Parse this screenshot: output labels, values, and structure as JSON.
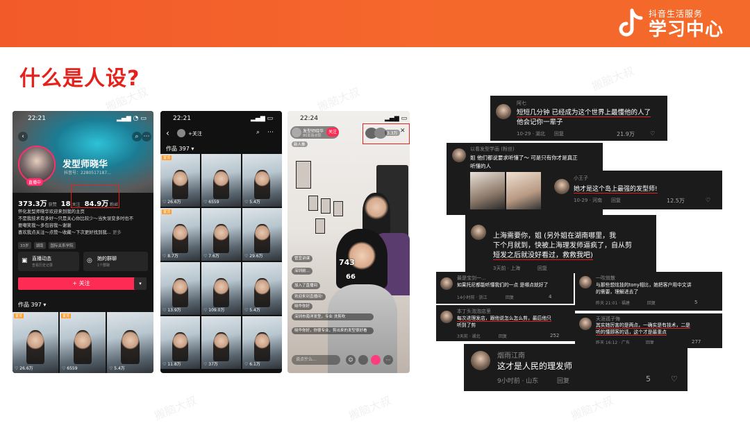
{
  "brand": {
    "small": "抖音生活服务",
    "big": "学习中心"
  },
  "title": "什么是人设?",
  "watermark": "搬脑大叔",
  "phone1": {
    "time": "22:21",
    "name": "发型师晓华",
    "id": "抖音号：2280517187...",
    "live": "直播中",
    "likes_value": "373.3万",
    "likes_label": "获赞",
    "following_value": "18",
    "following_label": "关注",
    "fans_value": "84.9万",
    "fans_label": "粉丝",
    "bio": [
      "怀化发型师晓华欢迎来到我的主页",
      "不是我技术有多好～只是关心你比较少～当失误变多时也不",
      "要嘲笑我～多包容我～谢谢",
      "喜欢我点关注～点赞～收藏～下次更好找到我..."
    ],
    "bio_more": "更多",
    "tags": [
      "33岁",
      "湖南",
      "国际关系学院"
    ],
    "card1_title": "直播动态",
    "card1_sub": "查看历史记录",
    "card2_title": "她的群聊",
    "card2_sub": "1个群聊",
    "follow_label": "+ 关注",
    "more_label": "▾",
    "works_label": "作品 397 ▾",
    "thumbs": [
      {
        "count": "♡ 26.6万",
        "pin": "置顶"
      },
      {
        "count": "♡ 6559",
        "pin": "置顶"
      },
      {
        "count": "♡ 5.4万",
        "pin": ""
      }
    ]
  },
  "phone2": {
    "time": "22:21",
    "follow_label": "+关注",
    "works_label": "作品 397 ▾",
    "thumbs": [
      {
        "count": "♡ 26.6万",
        "pin": "置顶"
      },
      {
        "count": "♡ 6559",
        "pin": ""
      },
      {
        "count": "♡ 5.4万",
        "pin": ""
      },
      {
        "count": "♡ 8.7万",
        "pin": "置顶"
      },
      {
        "count": "♡ 7.6万",
        "pin": ""
      },
      {
        "count": "♡ 29.6万",
        "pin": ""
      },
      {
        "count": "♡ 13.9万",
        "pin": ""
      },
      {
        "count": "♡ 109.0万",
        "pin": ""
      },
      {
        "count": "♡ 5.4万",
        "pin": ""
      },
      {
        "count": "♡ 11.8万",
        "pin": ""
      },
      {
        "count": "♡ 37万",
        "pin": ""
      },
      {
        "count": "♡ 6.1万",
        "pin": ""
      }
    ]
  },
  "phone3": {
    "time": "22:24",
    "host_name": "发型师晓华",
    "host_sub": "80本场点赞",
    "follow_label": "关注",
    "viewer_count": "3.3万",
    "badge1": "新人推",
    "like_count_1": "743",
    "like_count_2": "66",
    "comments": [
      "管宜讲课",
      "深圳前...",
      "加入了直播间",
      "欢迎来到直播间!",
      "晓华你好",
      "深圳市南洋发型，专业 洗剪吹",
      "晓华你好，你很专业，剪出来的发型很好看"
    ],
    "input_placeholder": "说点什么..."
  },
  "comments": [
    {
      "name": "阿七",
      "text1": "短短几分钟 已经成为这个世界上最懂他的人了",
      "text2": "他会记你一辈子",
      "meta": "10-29 · 湖北",
      "reply": "回复",
      "likes": "21.9万"
    },
    {
      "name": "以看发型学画 (粉丝)",
      "text1": "姐 他们都说要求听懂了～ 可是只有你才是真正",
      "text2": "听懂的人",
      "meta": "",
      "reply": "",
      "likes": ""
    },
    {
      "name": "小王子",
      "text1": "她才是这个岛上最强的发型师!",
      "text2": "",
      "meta": "10-29 · 河南",
      "reply": "回复",
      "likes": "12.5万"
    },
    {
      "name": "",
      "text1": "上海需要你，姐 (另外姐在湖南哪里，我",
      "text2": "下个月就到，快被上海理发师逼疯了，自从剪",
      "text3": "短发之后就没好看过，救救我吧)",
      "meta": "3天前 · 上海",
      "reply": "回复",
      "likes": ""
    },
    {
      "name": "最是宝剑一...",
      "text1": "如果托尼都能听懂我们的一点 是哪点就好了",
      "text2": "",
      "meta": "14小时前 · 浙江",
      "reply": "回复",
      "likes": "4"
    },
    {
      "name": "一吹就散",
      "text1": "与那些想炫技的tony相比，她把客户用中文讲",
      "text2": "的需要，理解进去了",
      "meta": "昨天 21:01 · 福建",
      "reply": "回复",
      "likes": "5"
    },
    {
      "name": "本丁头泡泡店里",
      "text1": "每次进理发店，跟他说怎么怎么剪，最后他只",
      "text2": "听到了剪",
      "meta": "3天前 · 湖北",
      "reply": "回复",
      "likes": "252"
    },
    {
      "name": "天涯孤子悔",
      "text1": "其实她厉害的是两点，一确实是有技术，二是",
      "text2": "听的懂顾客的话，这个才是最重点",
      "meta": "昨天 16:12 · 广东",
      "reply": "回复",
      "likes": "277"
    },
    {
      "name": "烟雨江南",
      "text1": "这才是人民的理发师",
      "text2": "",
      "meta": "9小时前 · 山东",
      "reply": "回复",
      "likes": "5"
    }
  ]
}
